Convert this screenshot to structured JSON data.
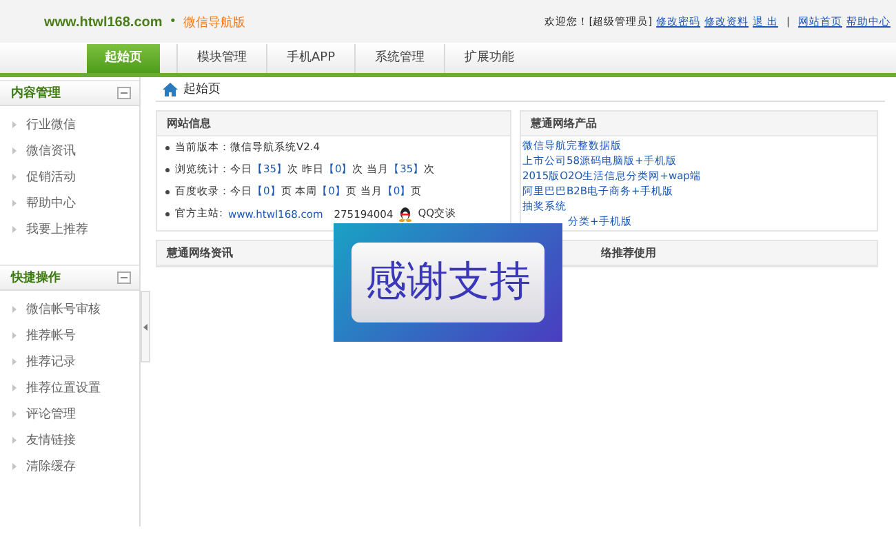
{
  "header": {
    "site": "www.htwl168.com",
    "dot": "•",
    "edition": "微信导航版",
    "welcome": "欢迎您！[超级管理员]",
    "links": [
      "修改密码",
      "修改资料",
      "退 出",
      "网站首页",
      "帮助中心"
    ],
    "separator": "|"
  },
  "tabs": [
    {
      "label": "起始页",
      "selected": true
    },
    {
      "label": "模块管理",
      "selected": false
    },
    {
      "label": "手机APP",
      "selected": false
    },
    {
      "label": "系统管理",
      "selected": false
    },
    {
      "label": "扩展功能",
      "selected": false
    }
  ],
  "sidebar": [
    {
      "title": "内容管理",
      "expanded": true,
      "items": [
        "行业微信",
        "微信资讯",
        "促销活动",
        "帮助中心",
        "我要上推荐"
      ]
    },
    {
      "title": "快捷操作",
      "expanded": true,
      "items": [
        "微信帐号审核",
        "推荐帐号",
        "推荐记录",
        "推荐位置设置",
        "评论管理",
        "友情链接",
        "清除缓存"
      ]
    }
  ],
  "breadcrumb": "起始页",
  "site_info": {
    "title": "网站信息",
    "lines": [
      "当前版本：微信导航系统V2.4",
      "浏览统计：今日【35】次 昨日【0】次 当月【35】次",
      "百度收录：今日【0】页 本周【0】页 当月【0】页"
    ],
    "official_label": "官方主站:",
    "official_link": "www.htwl168.com",
    "qq_number": "275194004",
    "qq_chat": "QQ交谈"
  },
  "products": {
    "title": "慧通网络产品",
    "items": [
      "微信导航完整数据版",
      "上市公司58源码电脑版+手机版",
      "2015版O2O生活信息分类网+wap端",
      "阿里巴巴B2B电子商务+手机版",
      "抽奖系统"
    ],
    "partly_covered_item": "分类+手机版"
  },
  "news": {
    "title": "慧通网络资讯"
  },
  "recommend": {
    "title": "络推荐使用"
  },
  "overlay": {
    "text": "感谢支持"
  }
}
